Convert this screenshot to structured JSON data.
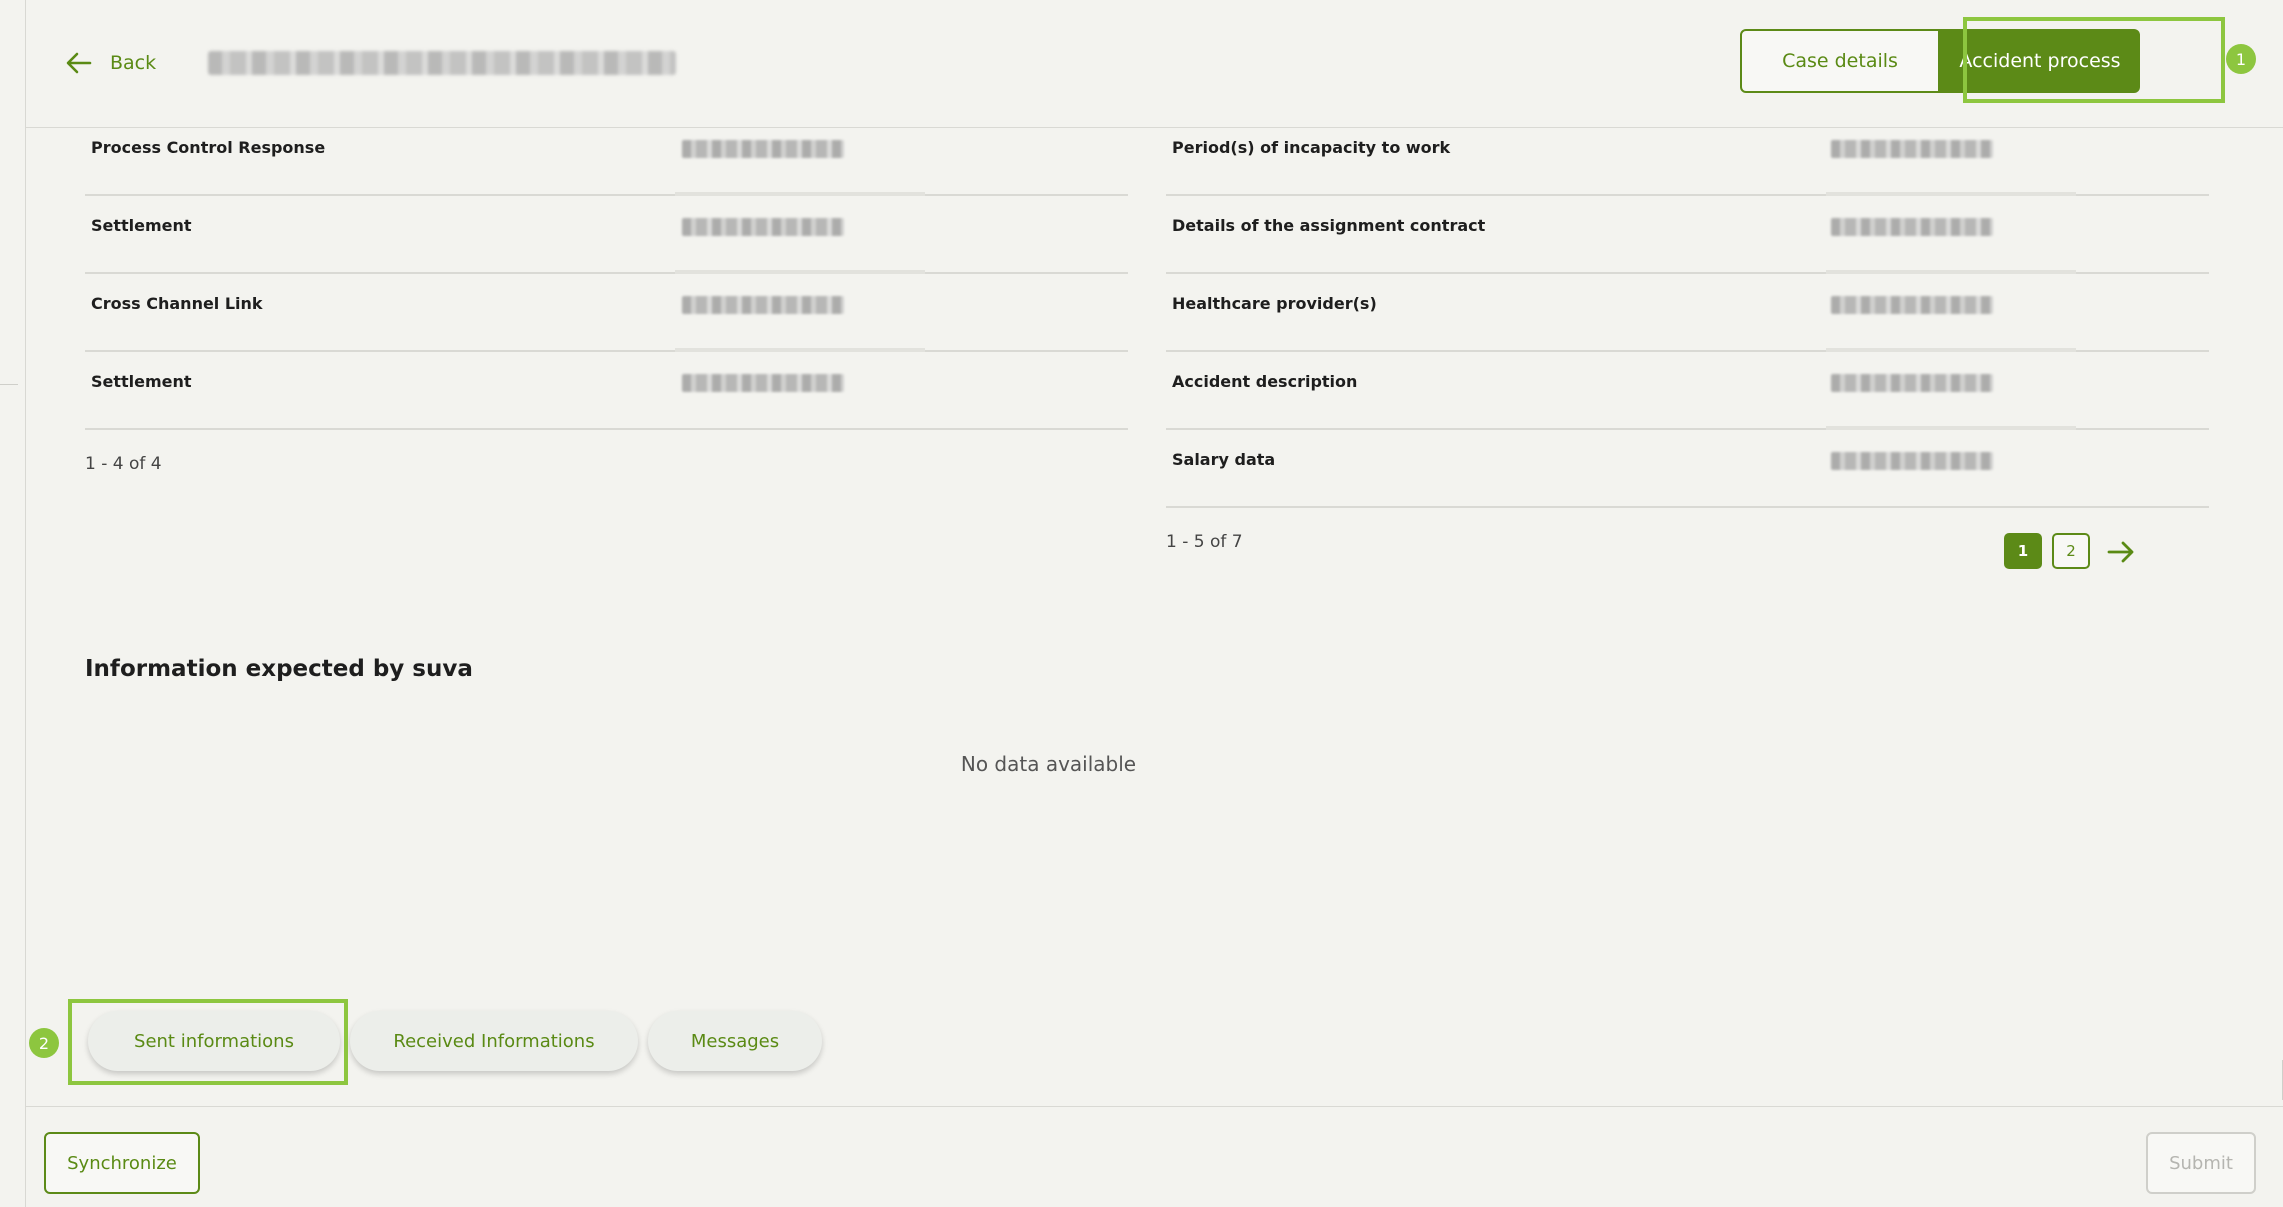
{
  "header": {
    "back_label": "Back",
    "tabs": {
      "case_details": "Case details",
      "accident_process": "Accident process"
    }
  },
  "markers": [
    "1",
    "2"
  ],
  "sent_left": {
    "rows": [
      {
        "name": "Process Control Response"
      },
      {
        "name": "Settlement"
      },
      {
        "name": "Cross Channel Link"
      },
      {
        "name": "Settlement"
      }
    ],
    "pager": "1 - 4 of 4"
  },
  "sent_right": {
    "rows": [
      {
        "name": "Period(s) of incapacity to work"
      },
      {
        "name": "Details of the assignment contract"
      },
      {
        "name": "Healthcare provider(s)"
      },
      {
        "name": "Accident description"
      },
      {
        "name": "Salary data"
      }
    ],
    "pager": "1 - 5 of 7",
    "pages": [
      "1",
      "2"
    ],
    "current_page": 1
  },
  "expected": {
    "title": "Information expected by suva",
    "empty_text": "No data available"
  },
  "bottom_tabs": {
    "sent": "Sent informations",
    "received": "Received Informations",
    "messages": "Messages"
  },
  "footer": {
    "synchronize": "Synchronize",
    "submit": "Submit"
  },
  "colors": {
    "accent": "#5c8a17",
    "highlight": "#8dc63f",
    "background": "#f3f3ef"
  },
  "icons": {
    "back": "arrow-left-icon",
    "next": "arrow-right-icon"
  }
}
